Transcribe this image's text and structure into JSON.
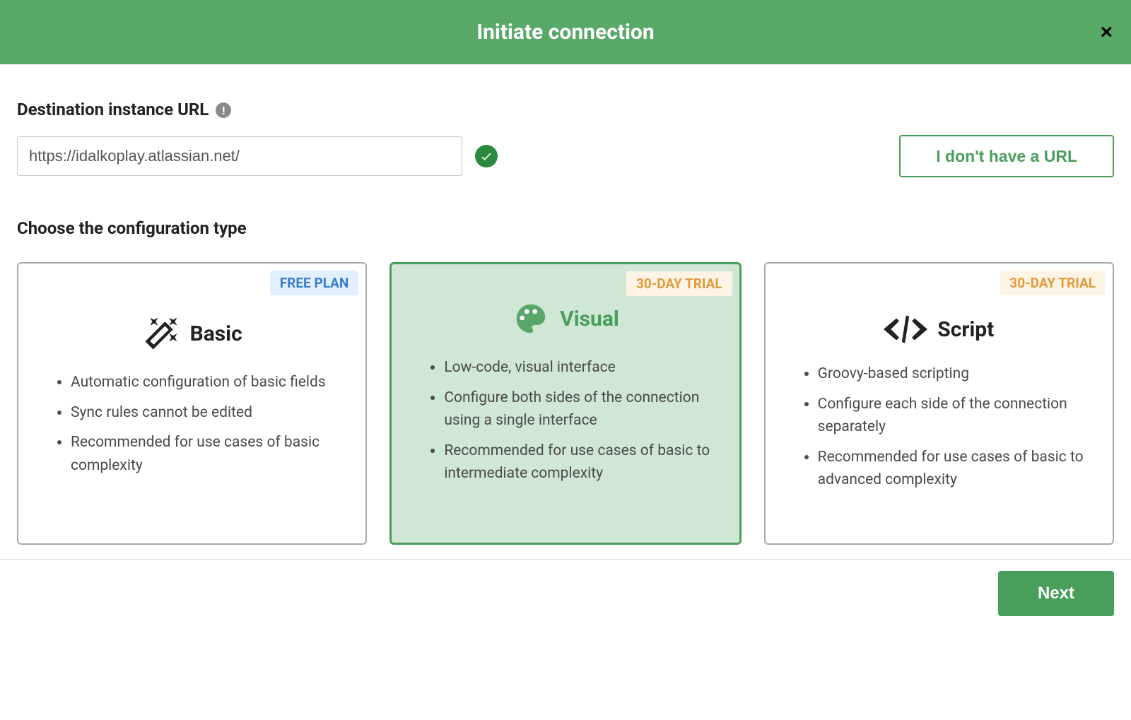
{
  "header": {
    "title": "Initiate connection",
    "close_icon": "×"
  },
  "destination": {
    "label": "Destination instance URL",
    "info_icon": "!",
    "url_value": "https://idalkoplay.atlassian.net/",
    "no_url_label": "I don't have a URL"
  },
  "config": {
    "title": "Choose the configuration type",
    "cards": [
      {
        "badge_type": "free",
        "badge_text": "FREE PLAN",
        "icon": "wand",
        "title": "Basic",
        "title_class": "",
        "selected": false,
        "points": [
          "Automatic configuration of basic fields",
          "Sync rules cannot be edited",
          "Recommended for use cases of basic complexity"
        ]
      },
      {
        "badge_type": "trial",
        "badge_text": "30-DAY TRIAL",
        "icon": "palette",
        "title": "Visual",
        "title_class": "green",
        "selected": true,
        "points": [
          "Low-code, visual interface",
          "Configure both sides of the connection using a single interface",
          "Recommended for use cases of basic to intermediate complexity"
        ]
      },
      {
        "badge_type": "trial",
        "badge_text": "30-DAY TRIAL",
        "icon": "code",
        "title": "Script",
        "title_class": "",
        "selected": false,
        "points": [
          "Groovy-based scripting",
          "Configure each side of the connection separately",
          "Recommended for use cases of basic to advanced complexity"
        ]
      }
    ]
  },
  "footer": {
    "next_label": "Next"
  }
}
